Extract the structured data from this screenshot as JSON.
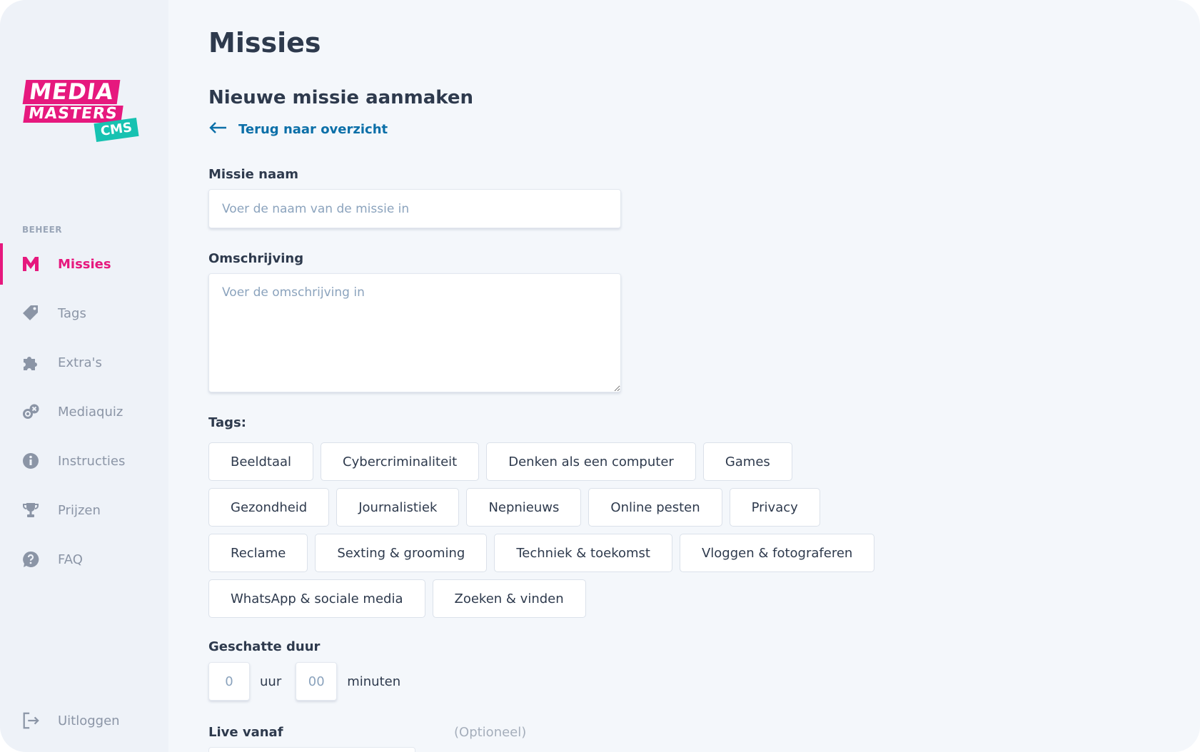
{
  "sidebar": {
    "logo": {
      "line1": "MEDIA",
      "line2": "MASTERS",
      "badge": "CMS"
    },
    "section_label": "BEHEER",
    "items": [
      {
        "label": "Missies",
        "icon": "m-letter-icon",
        "active": true
      },
      {
        "label": "Tags",
        "icon": "tag-icon",
        "active": false
      },
      {
        "label": "Extra's",
        "icon": "puzzle-icon",
        "active": false
      },
      {
        "label": "Mediaquiz",
        "icon": "quiz-icon",
        "active": false
      },
      {
        "label": "Instructies",
        "icon": "info-icon",
        "active": false
      },
      {
        "label": "Prijzen",
        "icon": "trophy-icon",
        "active": false
      },
      {
        "label": "FAQ",
        "icon": "question-icon",
        "active": false
      }
    ],
    "logout_label": "Uitloggen"
  },
  "main": {
    "page_title": "Missies",
    "form_title": "Nieuwe missie aanmaken",
    "back_link": "Terug naar overzicht",
    "name_label": "Missie naam",
    "name_placeholder": "Voer de naam van de missie in",
    "name_value": "",
    "description_label": "Omschrijving",
    "description_placeholder": "Voer de omschrijving in",
    "description_value": "",
    "tags_label": "Tags:",
    "tags": [
      [
        "Beeldtaal",
        "Cybercriminaliteit",
        "Denken als een computer",
        "Games"
      ],
      [
        "Gezondheid",
        "Journalistiek",
        "Nepnieuws",
        "Online pesten",
        "Privacy"
      ],
      [
        "Reclame",
        "Sexting & grooming",
        "Techniek & toekomst",
        "Vloggen & fotograferen"
      ],
      [
        "WhatsApp & sociale media",
        "Zoeken & vinden"
      ]
    ],
    "duration_label": "Geschatte duur",
    "hours_placeholder": "0",
    "hours_unit": "uur",
    "minutes_placeholder": "00",
    "minutes_unit": "minuten",
    "live_label": "Live vanaf",
    "live_optional": "(Optioneel)"
  },
  "colors": {
    "accent": "#e6197e",
    "link": "#0b6fa8",
    "logo_badge": "#17c2b1",
    "sidebar_bg": "#eef2f8",
    "main_bg": "#f4f7fb"
  }
}
